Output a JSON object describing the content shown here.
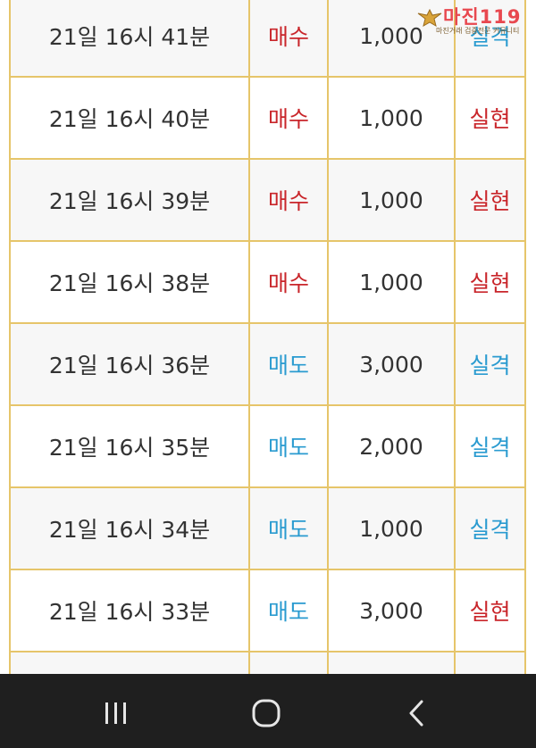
{
  "rows": [
    {
      "time": "21일 16시 41분",
      "side": "매수",
      "amount": "1,000",
      "result": "실격",
      "side_color": "red",
      "result_color": "blue"
    },
    {
      "time": "21일 16시 40분",
      "side": "매수",
      "amount": "1,000",
      "result": "실현",
      "side_color": "red",
      "result_color": "red"
    },
    {
      "time": "21일 16시 39분",
      "side": "매수",
      "amount": "1,000",
      "result": "실현",
      "side_color": "red",
      "result_color": "red"
    },
    {
      "time": "21일 16시 38분",
      "side": "매수",
      "amount": "1,000",
      "result": "실현",
      "side_color": "red",
      "result_color": "red"
    },
    {
      "time": "21일 16시 36분",
      "side": "매도",
      "amount": "3,000",
      "result": "실격",
      "side_color": "blue",
      "result_color": "blue"
    },
    {
      "time": "21일 16시 35분",
      "side": "매도",
      "amount": "2,000",
      "result": "실격",
      "side_color": "blue",
      "result_color": "blue"
    },
    {
      "time": "21일 16시 34분",
      "side": "매도",
      "amount": "1,000",
      "result": "실격",
      "side_color": "blue",
      "result_color": "blue"
    },
    {
      "time": "21일 16시 33분",
      "side": "매도",
      "amount": "3,000",
      "result": "실현",
      "side_color": "blue",
      "result_color": "red"
    }
  ],
  "colors": {
    "red": "#c9262b",
    "blue": "#2a9bd0",
    "border": "#e6c56a",
    "navbar": "#1f1f1f"
  },
  "watermark": {
    "title": "마진119",
    "subtitle": "마진거래 검증전문 커뮤니티"
  },
  "navbar": {
    "icons": [
      "recent-apps-icon",
      "home-icon",
      "back-icon"
    ]
  }
}
